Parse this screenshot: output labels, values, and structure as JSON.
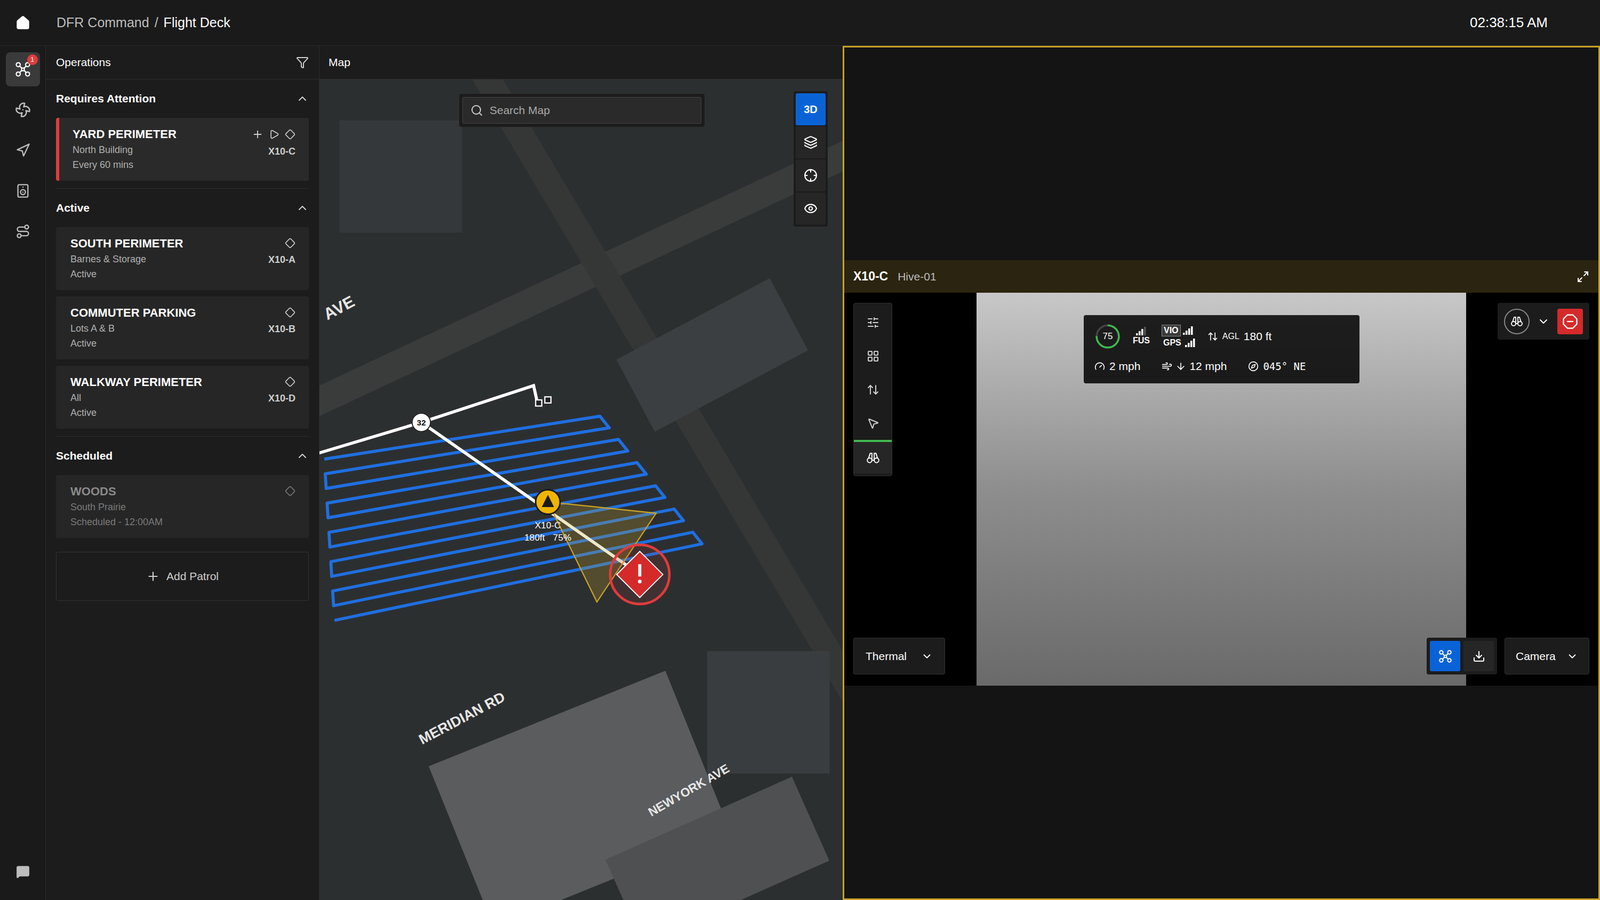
{
  "header": {
    "breadcrumb": [
      "DFR Command",
      "Flight Deck"
    ],
    "separator": "/",
    "time": "02:38:15 AM"
  },
  "rail": {
    "items": [
      {
        "kind": "operations",
        "selected": true,
        "badge": "1"
      },
      {
        "kind": "drones",
        "selected": false
      },
      {
        "kind": "navigation",
        "selected": false
      },
      {
        "kind": "docks",
        "selected": false
      },
      {
        "kind": "routes",
        "selected": false
      }
    ]
  },
  "operations": {
    "title": "Operations",
    "sections": [
      {
        "title": "Requires Attention",
        "expanded": true,
        "items": [
          {
            "kind": "attention",
            "name": "YARD PERIMETER",
            "location": "North Building",
            "status": "Every 60 mins",
            "drone": "X10-C"
          }
        ]
      },
      {
        "title": "Active",
        "expanded": true,
        "items": [
          {
            "kind": "active",
            "name": "SOUTH PERIMETER",
            "location": "Barnes & Storage",
            "status": "Active",
            "drone": "X10-A"
          },
          {
            "kind": "active",
            "name": "COMMUTER PARKING",
            "location": "Lots A & B",
            "status": "Active",
            "drone": "X10-B"
          },
          {
            "kind": "active",
            "name": "WALKWAY PERIMETER",
            "location": "All",
            "status": "Active",
            "drone": "X10-D"
          }
        ]
      },
      {
        "title": "Scheduled",
        "expanded": true,
        "items": [
          {
            "kind": "scheduled",
            "name": "WOODS",
            "location": "South Prairie",
            "status": "Scheduled - 12:00AM",
            "drone": ""
          }
        ]
      }
    ],
    "add_button": "Add Patrol"
  },
  "map": {
    "title": "Map",
    "search": {
      "placeholder": "Search Map"
    },
    "tools": [
      {
        "kind": "text",
        "label": "3D",
        "selected": true
      },
      {
        "kind": "layers",
        "label": "",
        "selected": false
      },
      {
        "kind": "locate",
        "label": "",
        "selected": false
      },
      {
        "kind": "view",
        "label": "",
        "selected": false
      }
    ],
    "streets": [
      "AVE",
      "MERIDIAN RD",
      "NEWYORK AVE"
    ],
    "waypoint": "32",
    "drone": {
      "name": "X10-C",
      "altitude": "180ft",
      "battery": "75%"
    },
    "alert": true
  },
  "feed": {
    "drone": "X10-C",
    "hive": "Hive-01",
    "tools": [
      {
        "kind": "settings",
        "selected": false
      },
      {
        "kind": "grid",
        "selected": false
      },
      {
        "kind": "altitude",
        "selected": false
      },
      {
        "kind": "pointer",
        "selected": false
      },
      {
        "kind": "binoculars",
        "selected": true
      }
    ],
    "telemetry": {
      "battery": {
        "value": "75",
        "level": 0.75
      },
      "fusion": {
        "label": "FUS",
        "level": 0.75
      },
      "sensors": [
        {
          "label": "VIO",
          "level": 1,
          "selected": true
        },
        {
          "label": "GPS",
          "level": 1,
          "selected": false
        }
      ],
      "agl": {
        "label": "AGL",
        "value": "180 ft"
      },
      "speed": "2 mph",
      "wind": "12 mph",
      "heading": "045° NE"
    },
    "view_mode": "Thermal",
    "camera": "Camera"
  }
}
